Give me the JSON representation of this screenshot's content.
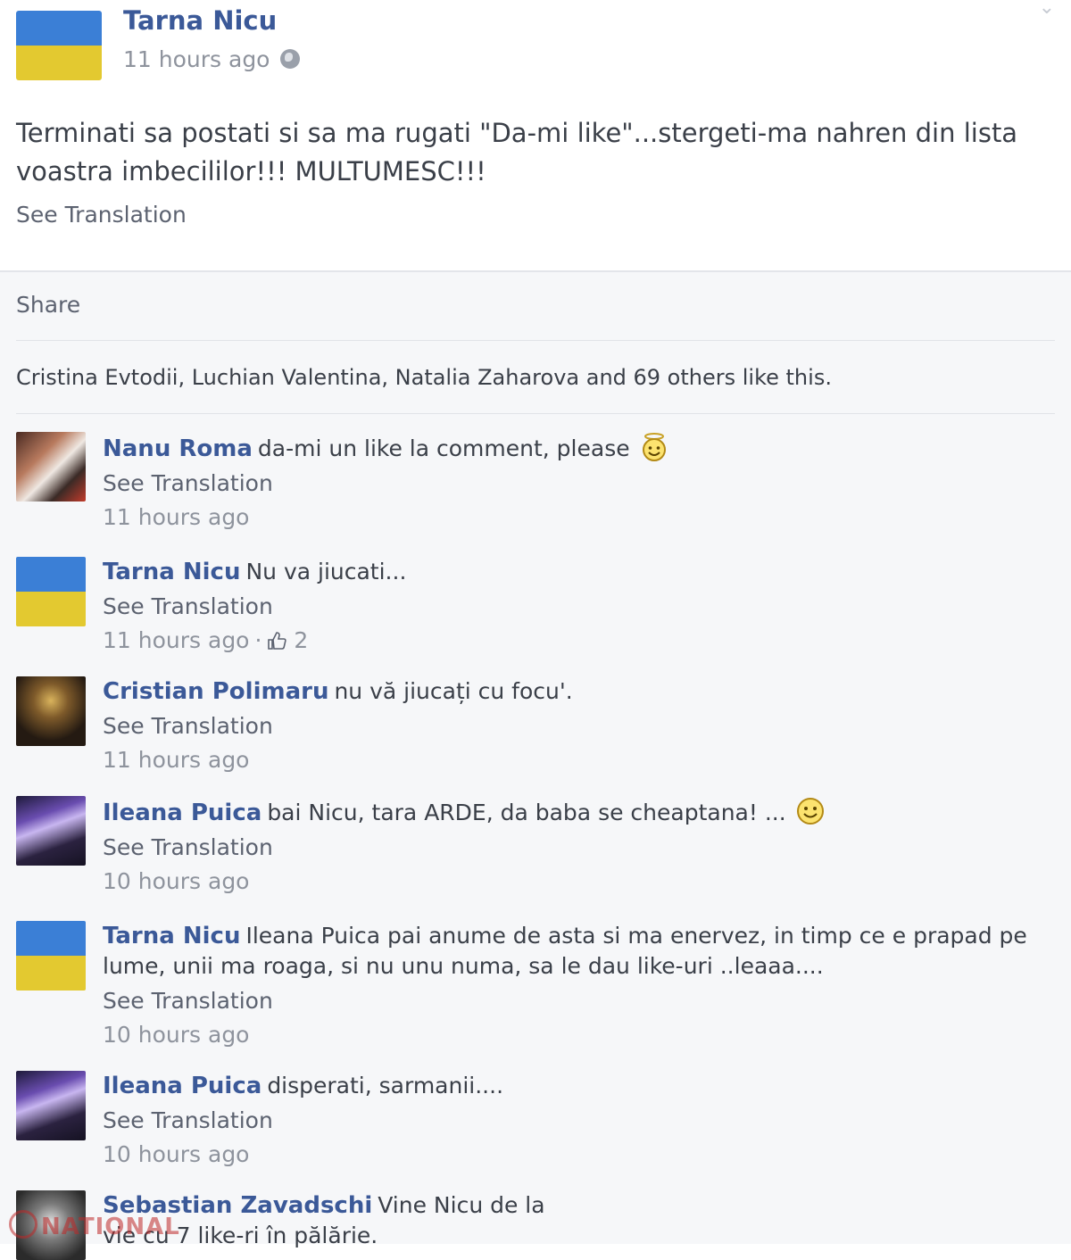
{
  "post": {
    "author": "Tarna Nicu",
    "time": "11 hours ago",
    "privacy_icon": "globe-icon",
    "text": "Terminati sa postati si sa ma rugati \"Da-mi like\"...stergeti-ma nahren din lista voastra imbecililor!!! MULTUMESC!!!",
    "see_translation": "See Translation"
  },
  "actions": {
    "share": "Share",
    "likes_summary": "Cristina Evtodii, Luchian Valentina, Natalia Zaharova and 69 others like this."
  },
  "comments": [
    {
      "author": "Nanu Roma",
      "text": "da-mi un like la comment, please",
      "emoji": "angel-smiley-icon",
      "see_translation": "See Translation",
      "time": "11 hours ago"
    },
    {
      "author": "Tarna Nicu",
      "text": "Nu va jiucati...",
      "see_translation": "See Translation",
      "time": "11 hours ago",
      "separator": "·",
      "like_count": "2"
    },
    {
      "author": "Cristian Polimaru",
      "text": "nu vă jiucați cu focu'.",
      "see_translation": "See Translation",
      "time": "11 hours ago"
    },
    {
      "author": "Ileana Puica",
      "text": "bai Nicu, tara ARDE, da baba se cheaptana! ...",
      "emoji": "smiley-icon",
      "see_translation": "See Translation",
      "time": "10 hours ago"
    },
    {
      "author": "Tarna Nicu",
      "text": "Ileana Puica pai anume de asta si ma enervez, in timp ce e prapad pe lume, unii ma roaga, si nu unu numa, sa le dau like-uri ..leaaa....",
      "see_translation": "See Translation",
      "time": "10 hours ago"
    },
    {
      "author": "Ileana Puica",
      "text": "disperati, sarmanii....",
      "see_translation": "See Translation",
      "time": "10 hours ago"
    },
    {
      "author": "Sebastian Zavadschi",
      "text": "Vine Nicu de la vie cu 7 like-ri în pălărie."
    }
  ],
  "watermark": "NATIONAL",
  "colors": {
    "name_link": "#3b5998",
    "muted": "#8e939d",
    "flag_blue": "#3b7fd6",
    "flag_yellow": "#e3c930",
    "feedback_bg": "#f6f7f9"
  }
}
